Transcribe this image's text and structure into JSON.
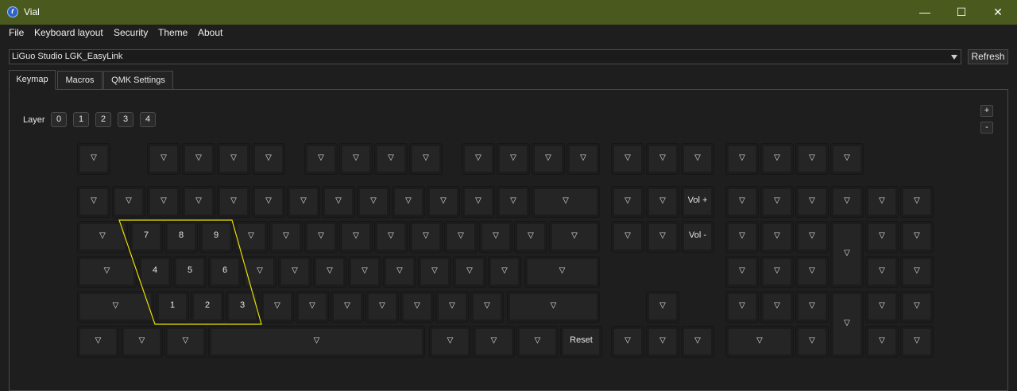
{
  "window": {
    "title": "Vial",
    "controls": {
      "minimize": "—",
      "maximize": "☐",
      "close": "✕"
    }
  },
  "menu": [
    "File",
    "Keyboard layout",
    "Security",
    "Theme",
    "About"
  ],
  "device": {
    "selected": "LiGuo Studio LGK_EasyLink",
    "refresh_label": "Refresh"
  },
  "tabs": [
    {
      "label": "Keymap",
      "active": true
    },
    {
      "label": "Macros",
      "active": false
    },
    {
      "label": "QMK Settings",
      "active": false
    }
  ],
  "layers": {
    "label": "Layer",
    "items": [
      "0",
      "1",
      "2",
      "3",
      "4"
    ]
  },
  "zoom": {
    "plus": "+",
    "minus": "-"
  },
  "keymap": {
    "transparent_glyph": "▽",
    "labeled_keys": [
      "7",
      "8",
      "9",
      "4",
      "5",
      "6",
      "1",
      "2",
      "3",
      "Vol +",
      "Vol -",
      "Reset"
    ]
  }
}
